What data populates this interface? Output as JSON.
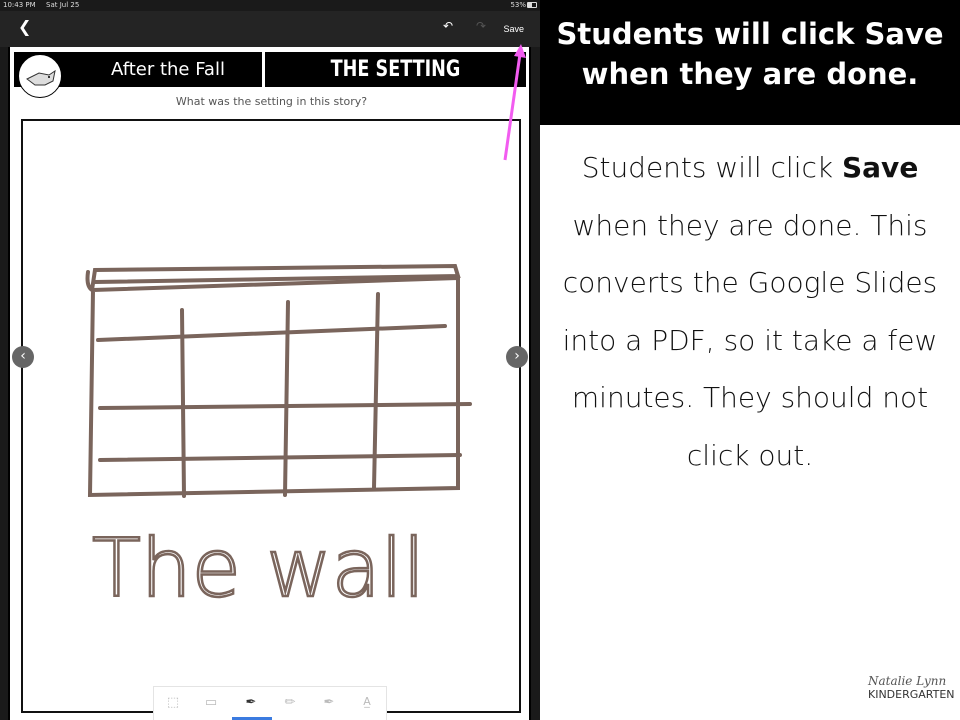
{
  "status_bar": {
    "time": "10:43 PM",
    "date": "Sat Jul 25",
    "battery": "53%",
    "battery_level": 0.53
  },
  "toolbar": {
    "back_icon": "chevron-left-icon",
    "undo_icon": "undo-icon",
    "redo_icon": "redo-icon",
    "save_label": "Save"
  },
  "worksheet": {
    "book_title": "After the Fall",
    "section_title": "THE SETTING",
    "question": "What was the setting in this story?",
    "drawing_text": "The wall",
    "stroke_color": "#7a655c"
  },
  "drawing_tools": [
    {
      "icon": "lasso-select-icon"
    },
    {
      "icon": "eraser-icon"
    },
    {
      "icon": "pen-icon",
      "selected": true
    },
    {
      "icon": "pencil-icon"
    },
    {
      "icon": "marker-icon"
    },
    {
      "icon": "text-icon"
    }
  ],
  "annotation": {
    "arrow_color": "#f25cf0"
  },
  "instructions": {
    "heading": "Students will click Save when they are done.",
    "body_pre": "Students will click ",
    "body_bold": "Save",
    "body_post": " when they are done. This converts the Google Slides into a PDF, so it take a few minutes. They should not click out."
  },
  "branding": {
    "script": "Natalie Lynn",
    "name": "KINDERGARTEN"
  }
}
